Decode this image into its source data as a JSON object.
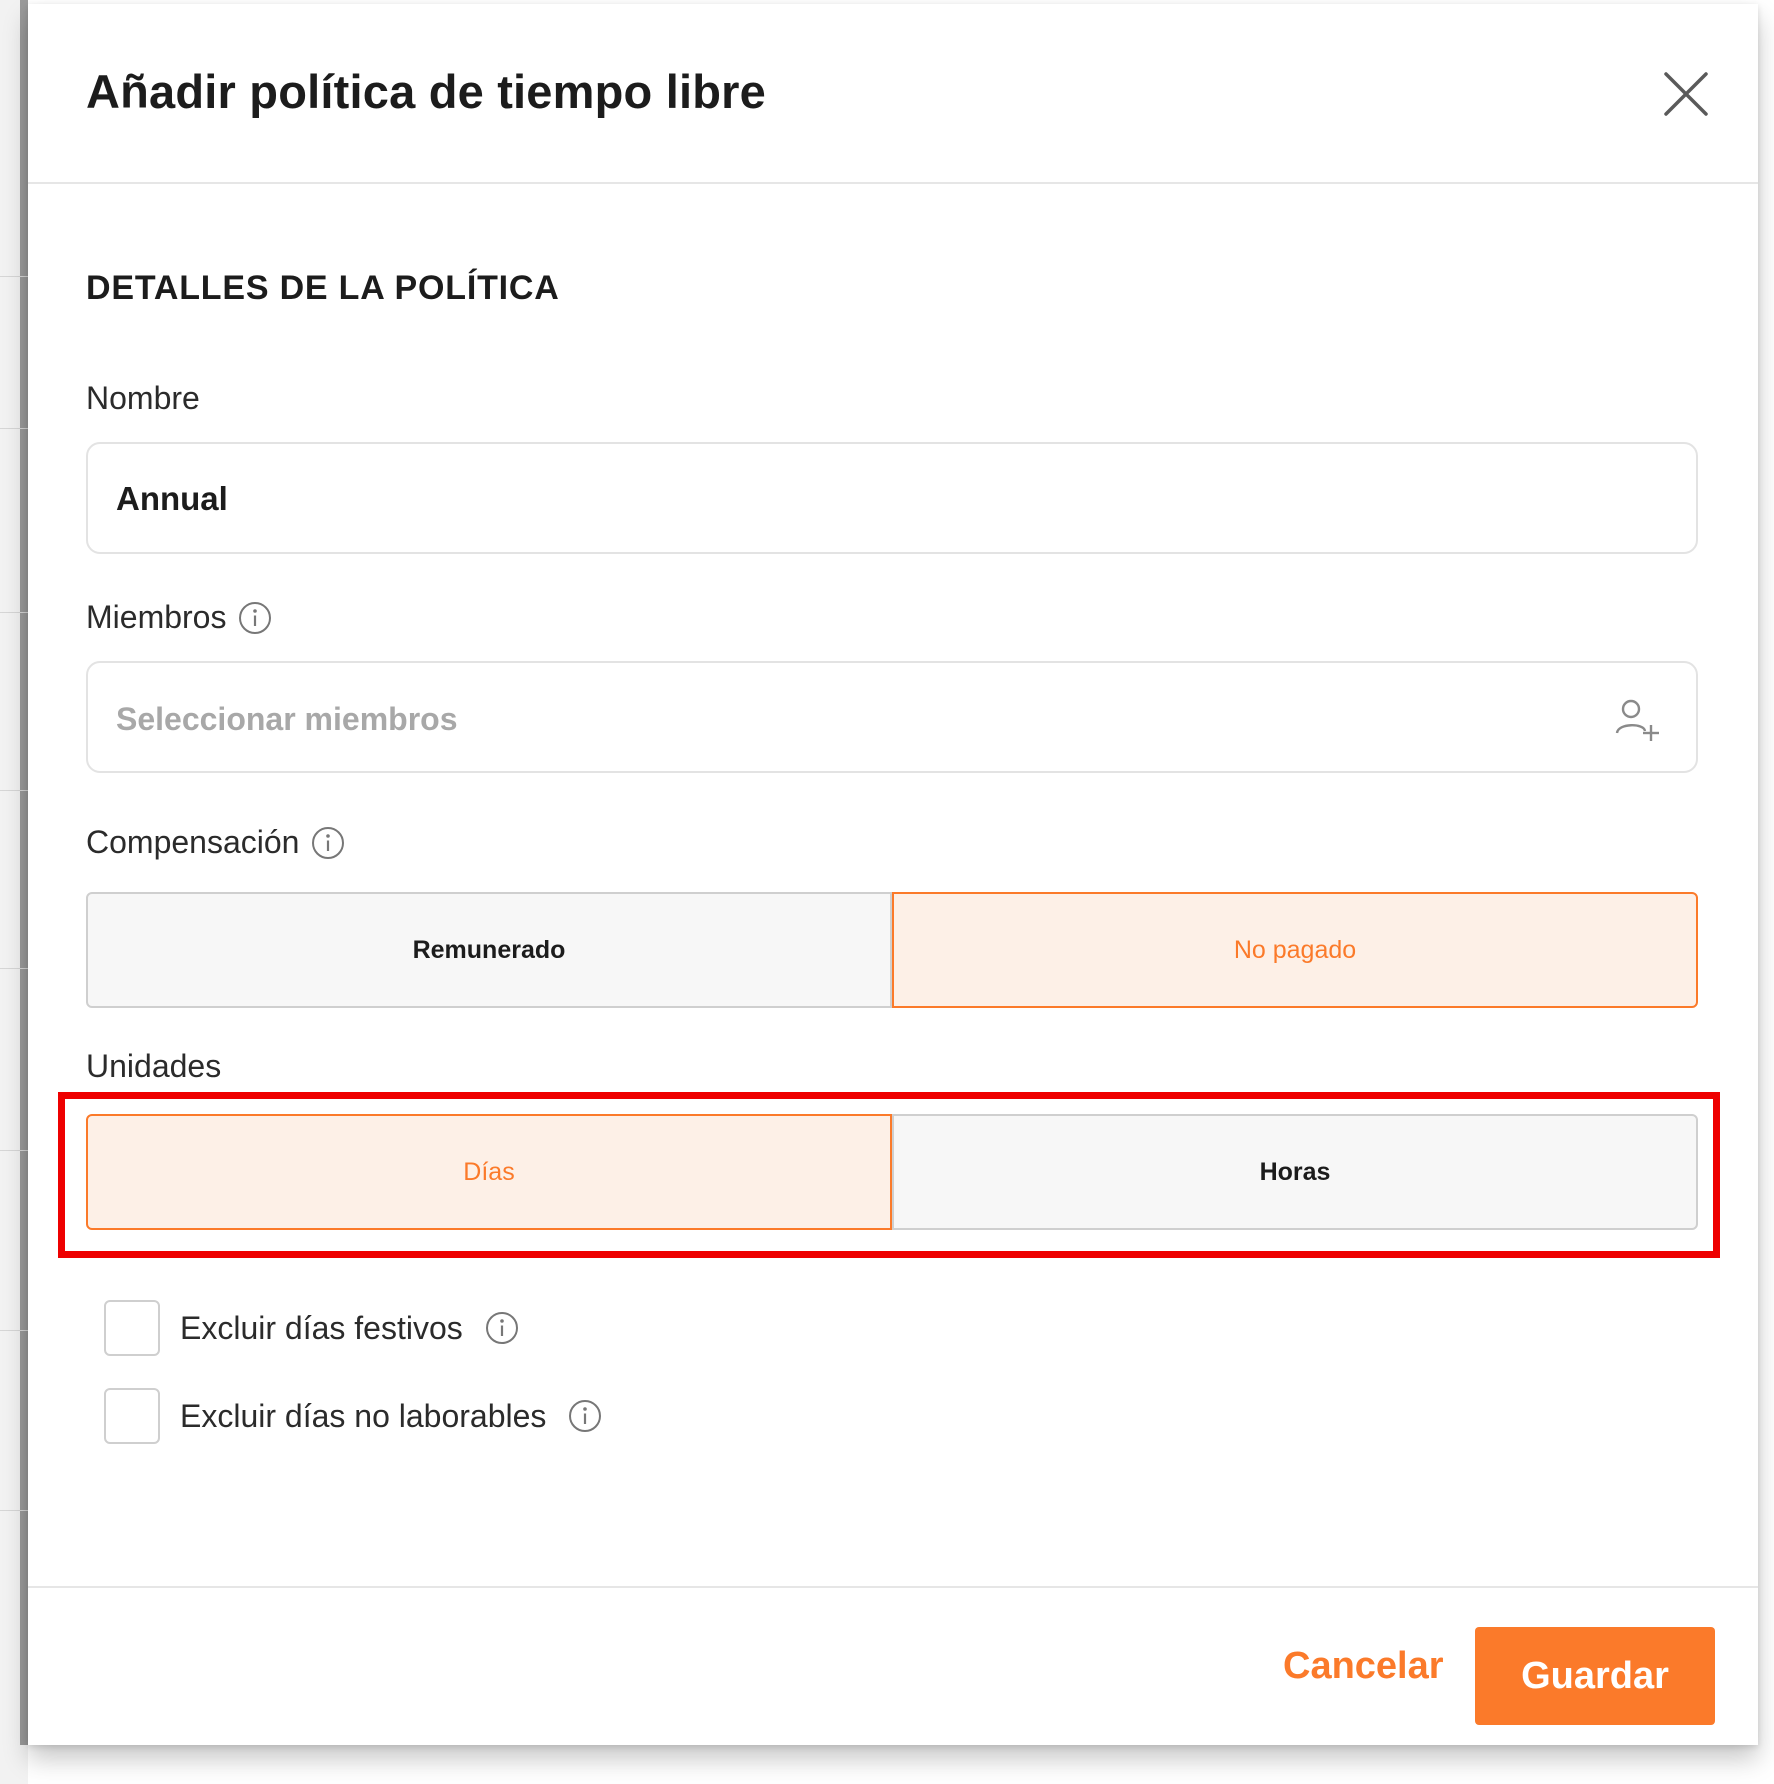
{
  "dialog": {
    "title": "Añadir política de tiempo libre",
    "section_title": "DETALLES DE LA POLÍTICA"
  },
  "fields": {
    "name": {
      "label": "Nombre",
      "value": "Annual"
    },
    "members": {
      "label": "Miembros",
      "placeholder": "Seleccionar miembros"
    },
    "compensation": {
      "label": "Compensación",
      "options": [
        "Remunerado",
        "No pagado"
      ],
      "selected": "No pagado"
    },
    "units": {
      "label": "Unidades",
      "options": [
        "Días",
        "Horas"
      ],
      "selected": "Días"
    }
  },
  "checkboxes": [
    {
      "label": "Excluir días festivos",
      "checked": false
    },
    {
      "label": "Excluir días no laborables",
      "checked": false
    }
  ],
  "footer": {
    "cancel_label": "Cancelar",
    "save_label": "Guardar"
  },
  "colors": {
    "accent": "#fb7a2a",
    "accent_bg": "#fdf0e7",
    "highlight": "#ee0000"
  },
  "icons": [
    "close-icon",
    "info-icon",
    "add-member-icon"
  ]
}
